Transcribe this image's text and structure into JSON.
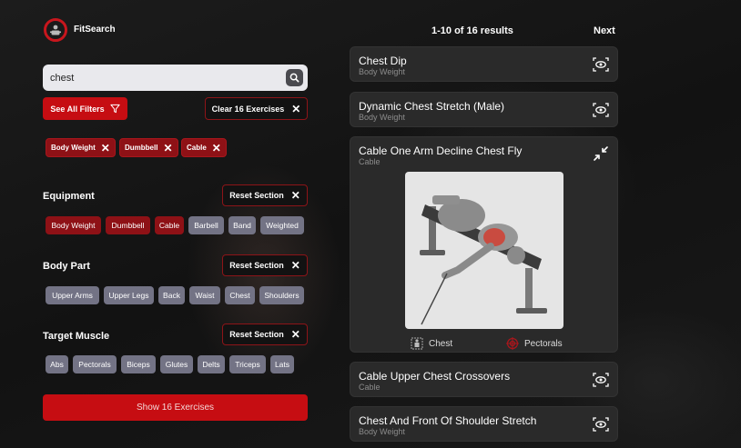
{
  "app": {
    "name": "FitSearch"
  },
  "search": {
    "value": "chest"
  },
  "buttons": {
    "see_all_filters": "See All Filters",
    "clear": "Clear 16 Exercises",
    "reset_section": "Reset Section",
    "show": "Show 16 Exercises"
  },
  "active_filters": [
    "Body Weight",
    "Dumbbell",
    "Cable"
  ],
  "sections": {
    "equipment": {
      "title": "Equipment",
      "chips": [
        {
          "label": "Body Weight",
          "selected": true
        },
        {
          "label": "Dumbbell",
          "selected": true
        },
        {
          "label": "Cable",
          "selected": true
        },
        {
          "label": "Barbell",
          "selected": false
        },
        {
          "label": "Band",
          "selected": false
        },
        {
          "label": "Weighted",
          "selected": false
        }
      ]
    },
    "body_part": {
      "title": "Body Part",
      "chips": [
        {
          "label": "Upper Arms",
          "selected": false
        },
        {
          "label": "Upper Legs",
          "selected": false
        },
        {
          "label": "Back",
          "selected": false
        },
        {
          "label": "Waist",
          "selected": false
        },
        {
          "label": "Chest",
          "selected": false
        },
        {
          "label": "Shoulders",
          "selected": false
        }
      ]
    },
    "target_muscle": {
      "title": "Target Muscle",
      "chips": [
        {
          "label": "Abs",
          "selected": false
        },
        {
          "label": "Pectorals",
          "selected": false
        },
        {
          "label": "Biceps",
          "selected": false
        },
        {
          "label": "Glutes",
          "selected": false
        },
        {
          "label": "Delts",
          "selected": false
        },
        {
          "label": "Triceps",
          "selected": false
        },
        {
          "label": "Lats",
          "selected": false
        }
      ]
    }
  },
  "results": {
    "summary": "1-10 of 16 results",
    "next": "Next",
    "items": [
      {
        "title": "Chest Dip",
        "equipment": "Body Weight"
      },
      {
        "title": "Dynamic Chest Stretch (Male)",
        "equipment": "Body Weight"
      },
      {
        "title": "Cable One Arm Decline Chest Fly",
        "equipment": "Cable",
        "body_part": "Chest",
        "target": "Pectorals"
      },
      {
        "title": "Cable Upper Chest Crossovers",
        "equipment": "Cable"
      },
      {
        "title": "Chest And Front Of Shoulder Stretch",
        "equipment": "Body Weight"
      }
    ]
  },
  "colors": {
    "accent": "#c60d12",
    "chip_selected": "#8e1116",
    "chip_default": "#737385"
  }
}
